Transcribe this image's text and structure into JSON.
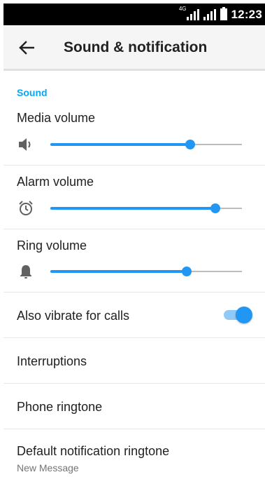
{
  "status_bar": {
    "network_label": "4G",
    "time": "12:23"
  },
  "toolbar": {
    "title": "Sound & notification"
  },
  "section": {
    "title": "Sound"
  },
  "volumes": [
    {
      "label": "Media volume",
      "icon": "speaker-icon",
      "level": 0.73
    },
    {
      "label": "Alarm volume",
      "icon": "alarm-clock-icon",
      "level": 0.86
    },
    {
      "label": "Ring volume",
      "icon": "bell-icon",
      "level": 0.71
    }
  ],
  "vibrate": {
    "label": "Also vibrate for calls",
    "enabled": true
  },
  "menu": {
    "interruptions": "Interruptions",
    "phone_ringtone": "Phone ringtone",
    "default_notification": "Default notification ringtone",
    "default_notification_value": "New Message"
  },
  "colors": {
    "accent": "#2196f3",
    "section_header": "#03a9f4"
  }
}
